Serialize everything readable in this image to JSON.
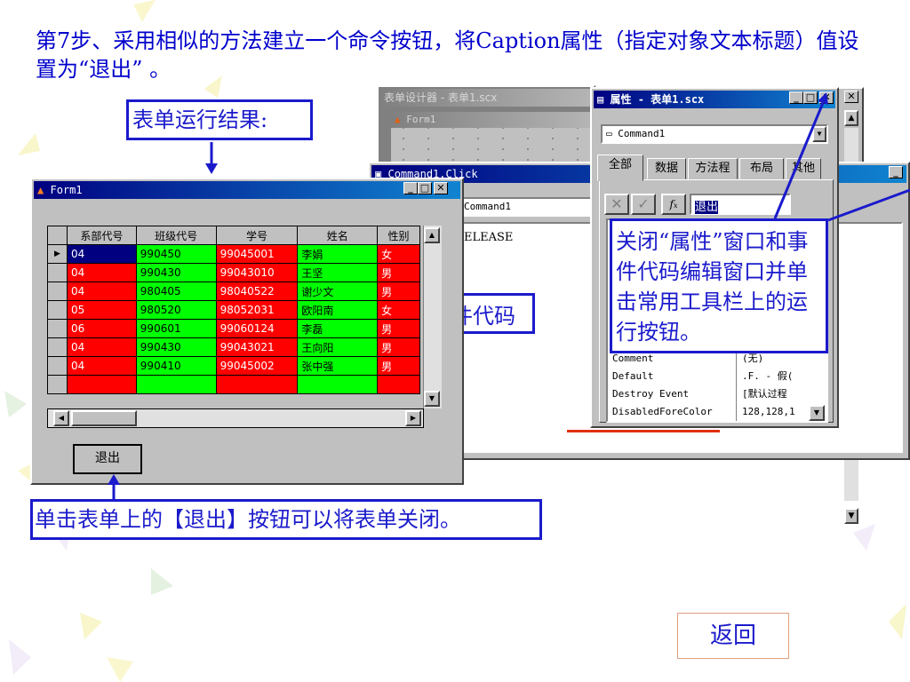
{
  "slide": {
    "title": "第7步、采用相似的方法建立一个命令按钮，将Caption属性（指定对象文本标题）值设置为“退出” 。",
    "run_result_label": "表单运行结果:",
    "bottom_note": "单击表单上的【退出】按钮可以将表单关闭。",
    "right_note": "关闭“属性”窗口和事件代码编辑窗口并单击常用工具栏上的运行按钮。",
    "partial_label": "件代码",
    "back_label": "返回"
  },
  "form_designer": {
    "title": "表单设计器 - 表单1.scx",
    "inner_form_title": "Form1"
  },
  "code_window": {
    "title": "Command1.Click",
    "object_field": "Command1",
    "code_text": "ELEASE"
  },
  "form1": {
    "title": "Form1",
    "columns": [
      "系部代号",
      "班级代号",
      "学号",
      "姓名",
      "性别"
    ],
    "rows": [
      [
        "04",
        "990450",
        "99045001",
        "李娟",
        "女"
      ],
      [
        "04",
        "990430",
        "99043010",
        "王坚",
        "男"
      ],
      [
        "04",
        "980405",
        "98040522",
        "谢少文",
        "男"
      ],
      [
        "05",
        "980520",
        "98052031",
        "欧阳南",
        "女"
      ],
      [
        "06",
        "990601",
        "99060124",
        "李磊",
        "男"
      ],
      [
        "04",
        "990430",
        "99043021",
        "王向阳",
        "男"
      ],
      [
        "04",
        "990410",
        "99045002",
        "张中强",
        "男"
      ]
    ],
    "exit_button": "退出"
  },
  "properties": {
    "title": "属性 - 表单1.scx",
    "object_select": "Command1",
    "tabs": [
      "全部",
      "数据",
      "方法程",
      "布局",
      "其他"
    ],
    "value_box": "退出",
    "rows": [
      {
        "name": "Comment",
        "value": "(无)"
      },
      {
        "name": "Default",
        "value": ".F. - 假("
      },
      {
        "name": "Destroy Event",
        "value": "[默认过程"
      },
      {
        "name": "DisabledForeColor",
        "value": "128,128,1"
      }
    ]
  },
  "colors": {
    "callout_border": "#1a1acc",
    "red_cell": "#ff0000",
    "green_cell": "#00ff00",
    "titlebar": "#000080"
  }
}
